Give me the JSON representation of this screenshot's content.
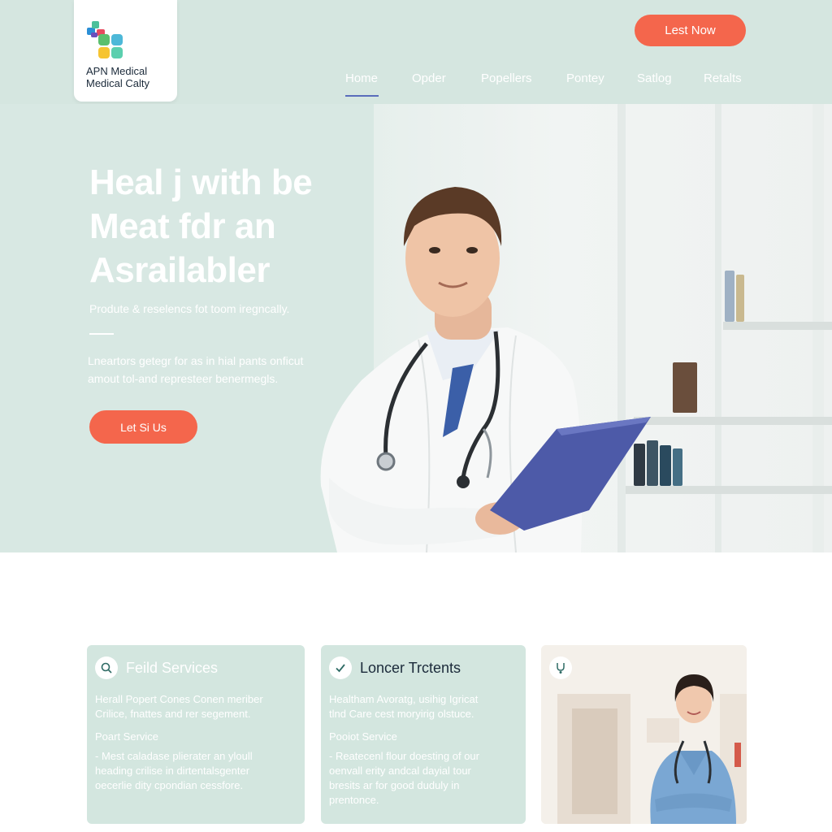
{
  "header": {
    "logo_line1": "APN Medical",
    "logo_line2": "Medical Calty",
    "cta_label": "Lest Now",
    "nav": [
      "Home",
      "Opder",
      "Popellers",
      "Pontey",
      "Satlog",
      "Retalts"
    ],
    "active_nav": "Home"
  },
  "hero": {
    "title_line1": "Heal j with be",
    "title_line2": "Meat fdr an",
    "title_line3": "Asrailabler",
    "subtitle": "Produte & reselencs fot toom iregncally.",
    "description_line1": "Lneartors getegr for as in hial pants onficut",
    "description_line2": "amout tol-and represteer benermegls.",
    "cta_label": "Let Si Us"
  },
  "cards": [
    {
      "icon": "search-icon",
      "title": "Feild Services",
      "text_line1": "Herall Popert Cones Conen meriber",
      "text_line2": "Crilice, fnattes and rer segement.",
      "label": "Poart Service",
      "bullet_line1": "- Mest caladase plierater an yloull",
      "bullet_line2": "heading crilise in dirtentalsgenter",
      "bullet_line3": "oecerlie dity cpondian cessfore."
    },
    {
      "icon": "check-icon",
      "title": "Loncer Trctents",
      "text_line1": "Healtham Avoratg, usihig Igricat",
      "text_line2": "tlnd Care cest moryirig olstuce.",
      "label": "Pooiot Service",
      "bullet_line1": "- Reatecenl flour doesting of our",
      "bullet_line2": "oenvall erity andcal dayial tour",
      "bullet_line3": "bresits ar for good duduly in",
      "bullet_line4": "prentonce."
    },
    {
      "icon": "stethoscope-icon"
    }
  ],
  "colors": {
    "accent": "#f4664c",
    "mint": "#d5e6e0",
    "nav_underline": "#5a6dbb",
    "clipboard": "#4d5aa8"
  }
}
